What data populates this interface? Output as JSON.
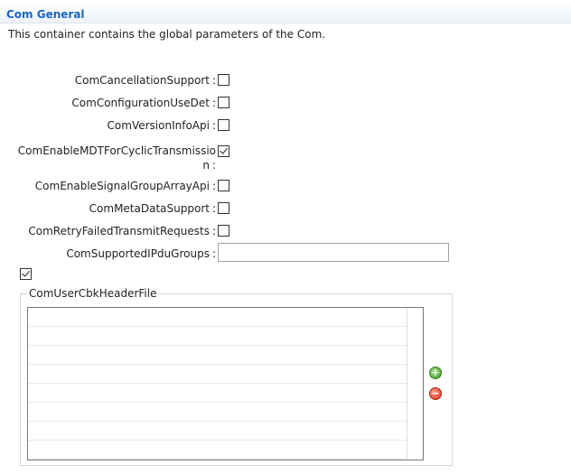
{
  "section": {
    "title": "Com General",
    "description": "This container contains the global parameters of the Com."
  },
  "params": [
    {
      "label": "ComCancellationSupport",
      "checked": false
    },
    {
      "label": "ComConfigurationUseDet",
      "checked": false
    },
    {
      "label": "ComVersionInfoApi",
      "checked": false
    },
    {
      "label_line1": "ComEnableMDTForCyclicTransmissio",
      "label_line2": "n",
      "checked": true
    },
    {
      "label": "ComEnableSignalGroupArrayApi",
      "checked": false
    },
    {
      "label": "ComMetaDataSupport",
      "checked": false
    },
    {
      "label": "ComRetryFailedTransmitRequests",
      "checked": false
    }
  ],
  "supported_ipdu_groups": {
    "label": "ComSupportedIPduGroups",
    "value": ""
  },
  "separator": ":",
  "user_cbk_header_file": {
    "enabled": true,
    "legend": "ComUserCbkHeaderFile",
    "rows": [
      "",
      "",
      "",
      "",
      "",
      "",
      "",
      ""
    ]
  },
  "icons": {
    "add": "plus-icon",
    "remove": "minus-icon"
  },
  "colors": {
    "title": "#1a66c2",
    "add": "#3e9c2a",
    "remove": "#d6321c"
  }
}
